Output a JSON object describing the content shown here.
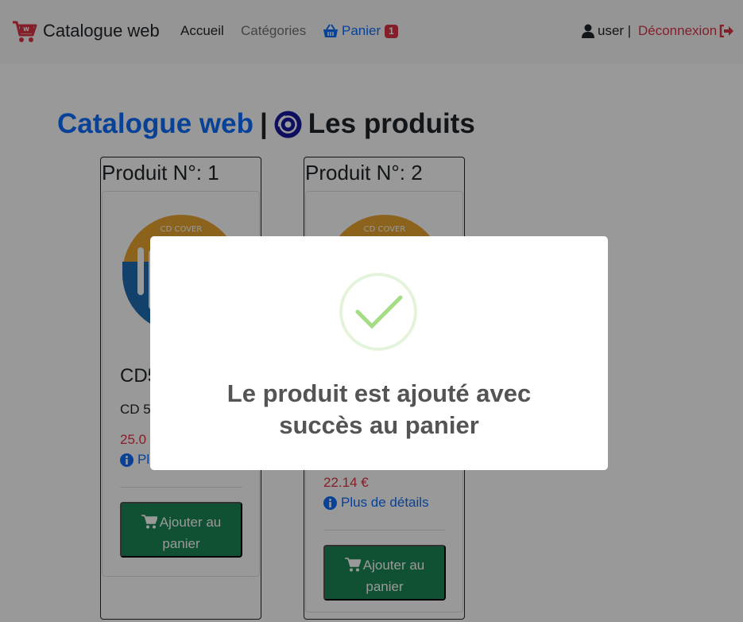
{
  "navbar": {
    "brand": "Catalogue web",
    "links": {
      "home": "Accueil",
      "categories": "Catégories",
      "cart": "Panier",
      "cart_count": "1"
    },
    "user": "user |",
    "logout": "Déconnexion"
  },
  "page": {
    "title_link": "Catalogue web",
    "separator": "|",
    "title": "Les produits"
  },
  "products": [
    {
      "header": "Produit N°: 1",
      "name": "CD5",
      "description": "CD 5",
      "price": "25.0",
      "details": "Pl",
      "add_label": "Ajouter au panier",
      "cover_label": "CD COVER"
    },
    {
      "header": "Produit N°: 2",
      "price": "22.14 €",
      "details": "Plus de détails",
      "add_label": "Ajouter au panier",
      "cover_label": "CD COVER"
    }
  ],
  "modal": {
    "message": "Le produit est ajouté avec succès au panier",
    "icon": "success-check-icon"
  },
  "colors": {
    "primary": "#0d6efd",
    "danger": "#dc3545",
    "success_button": "#198754",
    "check": "#a5dc86"
  }
}
